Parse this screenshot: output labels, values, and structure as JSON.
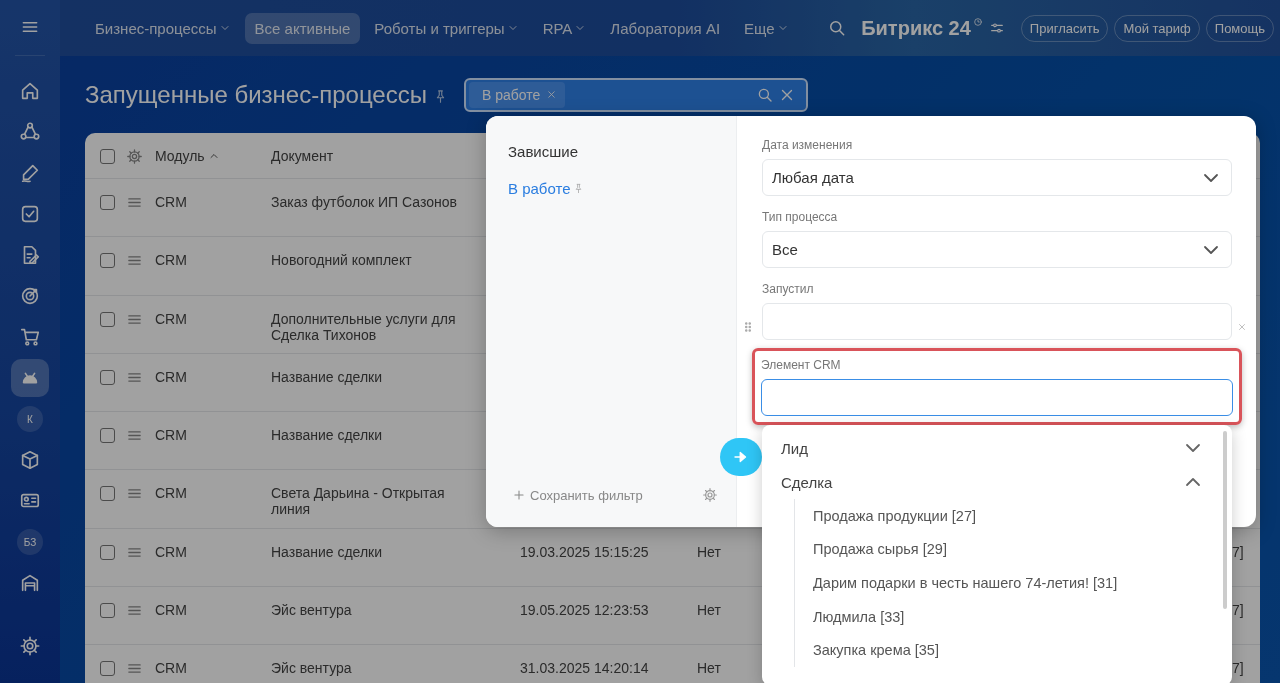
{
  "topbar": {
    "menu": [
      {
        "label": "Бизнес-процессы",
        "dropdown": true,
        "selected": false
      },
      {
        "label": "Все активные",
        "dropdown": false,
        "selected": true
      },
      {
        "label": "Роботы и триггеры",
        "dropdown": true,
        "selected": false
      },
      {
        "label": "RPA",
        "dropdown": true,
        "selected": false
      },
      {
        "label": "Лаборатория AI",
        "dropdown": false,
        "selected": false
      },
      {
        "label": "Еще",
        "dropdown": true,
        "selected": false
      }
    ],
    "logo": {
      "name": "Битрикс",
      "number": "24"
    },
    "buttons": [
      "Пригласить",
      "Мой тариф",
      "Помощь"
    ]
  },
  "sidebar": {
    "items": [
      {
        "kind": "home",
        "selected": false
      },
      {
        "kind": "flow",
        "selected": false
      },
      {
        "kind": "pen",
        "selected": false
      },
      {
        "kind": "task",
        "selected": false
      },
      {
        "kind": "doc",
        "selected": false
      },
      {
        "kind": "target",
        "selected": false
      },
      {
        "kind": "cart",
        "selected": false
      },
      {
        "kind": "robot",
        "selected": true
      },
      {
        "kind": "letter",
        "text": "К",
        "selected": false
      },
      {
        "kind": "box",
        "selected": false
      },
      {
        "kind": "card",
        "selected": false
      },
      {
        "kind": "letter",
        "text": "БЗ",
        "selected": false
      },
      {
        "kind": "garage",
        "selected": false
      }
    ]
  },
  "page_title": "Запущенные бизнес-процессы",
  "filter_search": {
    "tags": [
      "В работе"
    ]
  },
  "table": {
    "select_all_checked": false,
    "columns": [
      {
        "label": "Модуль",
        "sorted": true
      },
      {
        "label": "Документ",
        "sorted": false
      }
    ],
    "rows": [
      {
        "checked": false,
        "module": "CRM",
        "document": "Заказ футболок ИП Сазонов"
      },
      {
        "checked": false,
        "module": "CRM",
        "document": "Новогодний комплект"
      },
      {
        "checked": false,
        "module": "CRM",
        "document": "Дополнительные услуги для Сделка Тихонов"
      },
      {
        "checked": false,
        "module": "CRM",
        "document": "Название сделки"
      },
      {
        "checked": false,
        "module": "CRM",
        "document": "Название сделки"
      },
      {
        "checked": false,
        "module": "CRM",
        "document": "Света Дарьина - Открытая линия"
      },
      {
        "checked": false,
        "module": "CRM",
        "document": "Название сделки",
        "date": "19.03.2025 15:15:25",
        "status": "Нет",
        "column_6": "7]"
      },
      {
        "checked": false,
        "module": "CRM",
        "document": "Эйс вентура",
        "date": "19.05.2025 12:23:53",
        "status": "Нет",
        "column_6": "7]"
      },
      {
        "checked": false,
        "module": "CRM",
        "document": "Эйс вентура",
        "date": "31.03.2025 14:20:14",
        "status": "Нет",
        "column_6": "7]"
      }
    ]
  },
  "filter_popup": {
    "presets": [
      {
        "label": "Зависшие",
        "selected": false,
        "pinned": false
      },
      {
        "label": "В работе",
        "selected": true,
        "pinned": true
      }
    ],
    "save_filter": "Сохранить фильтр",
    "fields": [
      {
        "label": "Дата изменения",
        "kind": "select",
        "value": "Любая дата"
      },
      {
        "label": "Тип процесса",
        "kind": "select",
        "value": "Все"
      },
      {
        "label": "Запустил",
        "kind": "input",
        "removable": true,
        "focused": false,
        "highlighted": false
      },
      {
        "label": "Элемент CRM",
        "kind": "input",
        "removable": false,
        "focused": true,
        "highlighted": true
      }
    ],
    "dropdown": {
      "groups": [
        {
          "label": "Лид",
          "expanded": false
        },
        {
          "label": "Сделка",
          "expanded": true,
          "children": [
            "Продажа продукции [27]",
            "Продажа сырья [29]",
            "Дарим подарки в честь нашего 74-летия! [31]",
            "Людмила [33]",
            "Закупка крема [35]"
          ]
        }
      ]
    }
  }
}
